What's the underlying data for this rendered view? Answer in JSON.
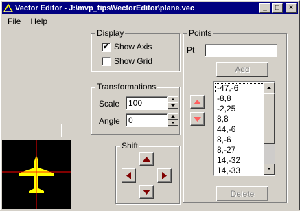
{
  "window": {
    "title": "Vector Editor - J:\\mvp_tips\\VectorEditor\\plane.vec",
    "minimize_glyph": "_",
    "maximize_glyph": "□",
    "close_glyph": "×"
  },
  "menu": {
    "items": [
      {
        "label": "File",
        "accel": "F",
        "rest": "ile"
      },
      {
        "label": "Help",
        "accel": "H",
        "rest": "elp"
      }
    ]
  },
  "display": {
    "title": "Display",
    "show_axis": {
      "label": "Show Axis",
      "checked": true,
      "check_glyph": "✔"
    },
    "show_grid": {
      "label": "Show Grid",
      "checked": false,
      "check_glyph": ""
    }
  },
  "transformations": {
    "title": "Transformations",
    "scale_label": "Scale",
    "scale_value": "100",
    "angle_label": "Angle",
    "angle_value": "0"
  },
  "shift": {
    "title": "Shift"
  },
  "points": {
    "title": "Points",
    "pt_label": "Pt",
    "pt_value": "",
    "add_label": "Add",
    "delete_label": "Delete",
    "items": [
      "-47,-6",
      "-8,8",
      "-2,25",
      "8,8",
      "44,-6",
      "8,-6",
      "8,-27",
      "14,-32",
      "14,-33"
    ]
  },
  "colors": {
    "titlebar": "#000080",
    "face": "#d4d0c8",
    "arrow_red": "#800000",
    "plane_yellow": "#ffff00",
    "axis_red": "#ff0000",
    "canvas_bg": "#000000"
  },
  "icons": {
    "app": "vector-editor-app-icon",
    "move_up": "move-up-icon",
    "move_down": "move-down-icon",
    "shift_up": "shift-up-icon",
    "shift_down": "shift-down-icon",
    "shift_left": "shift-left-icon",
    "shift_right": "shift-right-icon"
  }
}
